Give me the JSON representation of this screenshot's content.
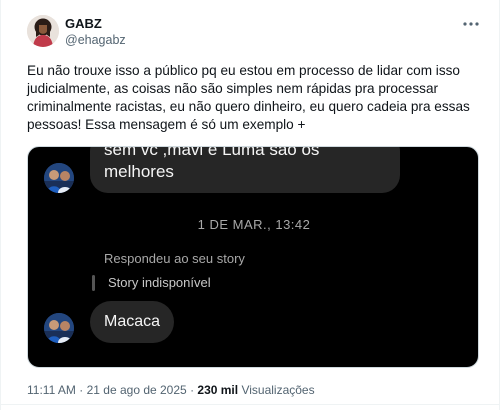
{
  "author": {
    "name": "GABZ",
    "handle": "@ehagabz",
    "avatar_icon": "profile-photo"
  },
  "more_icon": "more-horizontal-icon",
  "tweet_text": "Eu não trouxe isso a público pq eu estou em processo de lidar com isso judicialmente, as coisas não são simples nem rápidas pra processar criminalmente racistas, eu não quero dinheiro, eu quero cadeia pra essas pessoas! Essa mensagem é só um exemplo +",
  "screenshot": {
    "first_message": "sem vc ,mavi e Luma são os melhores",
    "date_separator": "1 DE MAR., 13:42",
    "replied_label": "Respondeu ao seu story",
    "story_label": "Story indisponível",
    "second_message": "Macaca"
  },
  "meta": {
    "time": "11:11 AM",
    "separator": "·",
    "date": "21 de ago de 2025",
    "views_count": "230 mil",
    "views_label": "Visualizações"
  },
  "colors": {
    "text": "#0f1419",
    "secondary": "#536471",
    "media_bg": "#000000",
    "bubble": "#262626"
  }
}
